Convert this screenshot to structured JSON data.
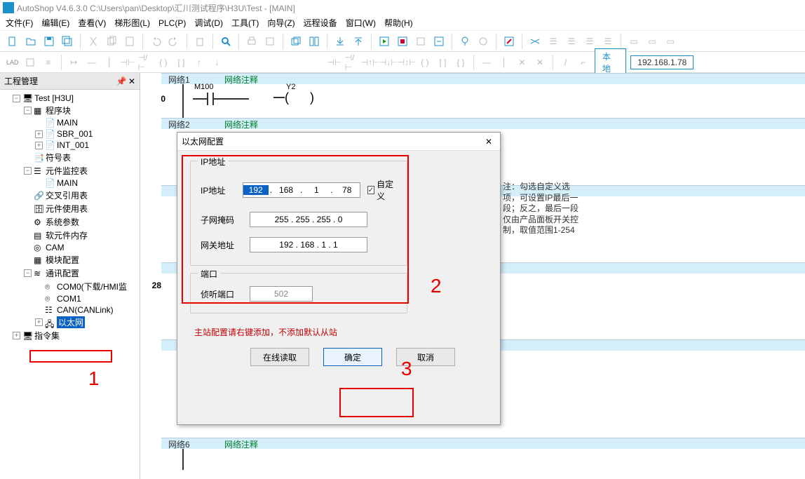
{
  "title": "AutoShop V4.6.3.0  C:\\Users\\pan\\Desktop\\汇川测试程序\\H3U\\Test - [MAIN]",
  "menu": [
    "文件(F)",
    "编辑(E)",
    "查看(V)",
    "梯形图(L)",
    "PLC(P)",
    "调试(D)",
    "工具(T)",
    "向导(Z)",
    "远程设备",
    "窗口(W)",
    "帮助(H)"
  ],
  "tb2": {
    "local": "本地",
    "ip": "192.168.1.78"
  },
  "panel_title": "工程管理",
  "tree": {
    "root": "Test [H3U]",
    "prog": "程序块",
    "main": "MAIN",
    "sbr": "SBR_001",
    "int": "INT_001",
    "sym": "符号表",
    "mon": "元件监控表",
    "mon_main": "MAIN",
    "xref": "交叉引用表",
    "use": "元件使用表",
    "param": "系统参数",
    "softmem": "软元件内存",
    "cam": "CAM",
    "modcfg": "模块配置",
    "commcfg": "通讯配置",
    "com0": "COM0(下载/HMI监",
    "com1": "COM1",
    "can": "CAN(CANLink)",
    "eth": "以太网",
    "cmdset": "指令集"
  },
  "rungs": {
    "r1": {
      "bar_l": "网络1",
      "bar_r": "网络注释",
      "num": "0",
      "contact": "M100",
      "coil": "Y2"
    },
    "r2": {
      "bar_l": "网络2",
      "bar_r": "网络注释",
      "num": "28"
    },
    "r6": {
      "bar_l": "网络6",
      "bar_r": "网络注释"
    }
  },
  "dialog": {
    "title": "以太网配置",
    "grp_ip": "IP地址",
    "ip_label": "IP地址",
    "ip": [
      "192",
      "168",
      "1",
      "78"
    ],
    "custom": "自定义",
    "mask_label": "子网掩码",
    "mask": "255  .  255  .  255  .   0",
    "gw_label": "网关地址",
    "gw": "192  .  168  .    1   .    1",
    "grp_port": "端口",
    "listen": "侦听端口",
    "port": "502",
    "note": "注：勾选自定义选项，可设置IP最后一段；反之，最后一段仅由产品面板开关控制，取值范围1-254",
    "redtext": "主站配置请右键添加，不添加默认从站",
    "btn_read": "在线读取",
    "btn_ok": "确定",
    "btn_cancel": "取消"
  },
  "annot": {
    "n1": "1",
    "n2": "2",
    "n3": "3"
  }
}
